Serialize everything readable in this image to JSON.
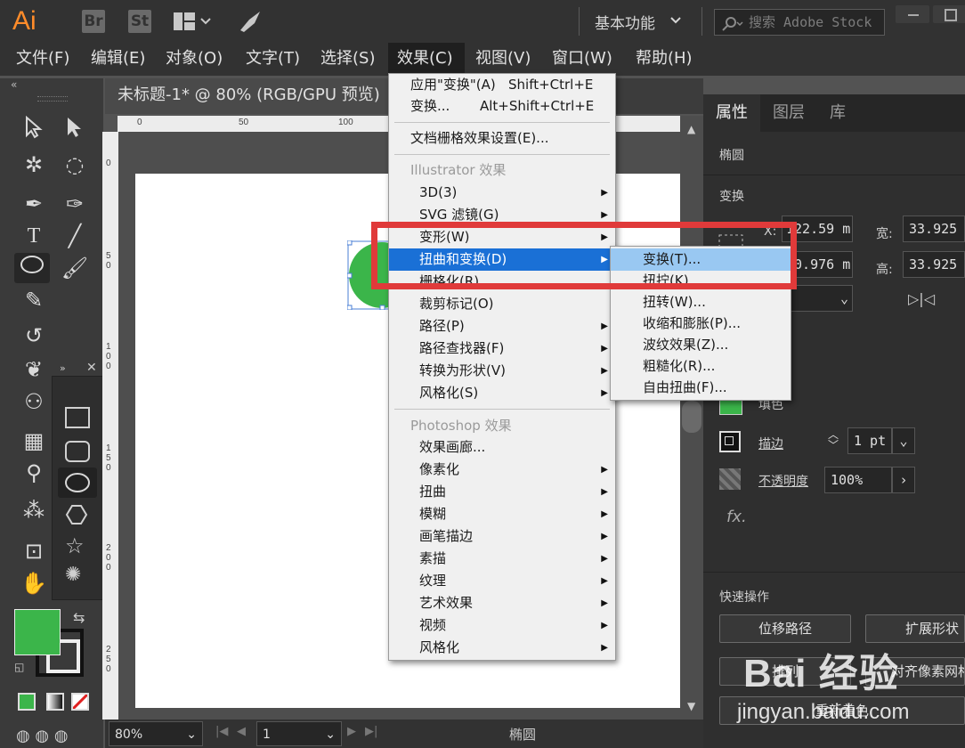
{
  "app": {
    "logo": "Ai",
    "toolbar_icons": [
      "Br",
      "St"
    ],
    "workspace": "基本功能",
    "stock_search_placeholder": "搜索 Adobe Stock"
  },
  "menubar": [
    "文件(F)",
    "编辑(E)",
    "对象(O)",
    "文字(T)",
    "选择(S)",
    "效果(C)",
    "视图(V)",
    "窗口(W)",
    "帮助(H)"
  ],
  "document": {
    "tab_title": "未标题-1* @ 80% (RGB/GPU 预览)",
    "ruler_h": [
      "0",
      "50",
      "100"
    ],
    "ruler_v": [
      "0",
      "5 0",
      "1 0 0",
      "1 5 0",
      "2 0 0",
      "2 5 0"
    ]
  },
  "effect_menu": {
    "apply_label": "应用\"变换\"(A)",
    "apply_shortcut": "Shift+Ctrl+E",
    "transform_label": "变换...",
    "transform_shortcut": "Alt+Shift+Ctrl+E",
    "doc_raster_settings": "文档栅格效果设置(E)...",
    "illustrator_header": "Illustrator 效果",
    "illustrator_items": [
      "3D(3)",
      "SVG 滤镜(G)",
      "变形(W)",
      "扭曲和变换(D)",
      "栅格化(R)...",
      "裁剪标记(O)",
      "路径(P)",
      "路径查找器(F)",
      "转换为形状(V)",
      "风格化(S)"
    ],
    "photoshop_header": "Photoshop 效果",
    "photoshop_items": [
      "效果画廊...",
      "像素化",
      "扭曲",
      "模糊",
      "画笔描边",
      "素描",
      "纹理",
      "艺术效果",
      "视频",
      "风格化"
    ]
  },
  "submenu": [
    "变换(T)...",
    "扭拧(K)...",
    "扭转(W)...",
    "收缩和膨胀(P)...",
    "波纹效果(Z)...",
    "粗糙化(R)...",
    "自由扭曲(F)..."
  ],
  "properties": {
    "tabs": [
      "属性",
      "图层",
      "库"
    ],
    "object_type": "椭圆",
    "transform_title": "变换",
    "x_label": "X:",
    "x_value": "122.59 m",
    "y_value": "50.976 m",
    "w_label": "宽:",
    "w_value": "33.925",
    "h_label": "高:",
    "h_value": "33.925",
    "fill_label": "填色",
    "stroke_label": "描边",
    "stroke_value": "1 pt",
    "opacity_label": "不透明度",
    "opacity_value": "100%",
    "fx": "fx.",
    "quick_actions": "快速操作",
    "btn_offset_path": "位移路径",
    "btn_expand_shape": "扩展形状",
    "btn_arrange": "排列",
    "btn_align_pixel": "对齐像素网格",
    "btn_recolor": "重新着色"
  },
  "status": {
    "zoom": "80%",
    "page": "1",
    "object": "椭圆"
  },
  "watermark": {
    "brand": "Bai 经验",
    "url": "jingyan.baidu.com"
  },
  "colors": {
    "fill": "#3bb54a",
    "highlight": "#1a70d6",
    "submenu_highlight": "#99c8f2",
    "callout": "#e03a3a"
  }
}
